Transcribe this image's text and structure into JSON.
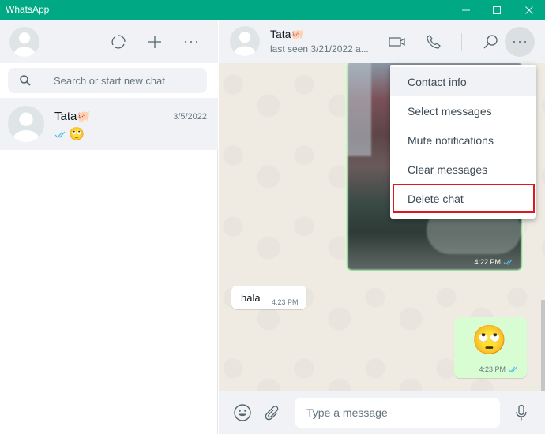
{
  "window": {
    "title": "WhatsApp",
    "accent_color": "#00a884",
    "controls": [
      "minimize",
      "maximize",
      "close"
    ]
  },
  "sidebar": {
    "header_icons": [
      "status-icon",
      "new-chat-icon",
      "more-options-icon"
    ],
    "search": {
      "placeholder": "Search or start new chat",
      "value": ""
    },
    "chats": [
      {
        "name": "Tata",
        "name_emoji": "🐖",
        "date": "3/5/2022",
        "preview_emoji": "🙄",
        "read_status": "double-check-blue"
      }
    ]
  },
  "chat": {
    "contact_name": "Tata",
    "contact_emoji": "🐖",
    "status": "last seen 3/21/2022 a...",
    "header_icons": [
      "video-call-icon",
      "voice-call-icon",
      "search-icon",
      "menu-icon"
    ],
    "messages": [
      {
        "type": "image",
        "direction": "outgoing",
        "time": "4:22 PM",
        "read_status": "double-check-blue"
      },
      {
        "type": "text",
        "direction": "incoming",
        "text": "hala",
        "time": "4:23 PM"
      },
      {
        "type": "emoji",
        "direction": "outgoing",
        "emoji": "🙄",
        "time": "4:23 PM",
        "read_status": "double-check-blue"
      }
    ],
    "composer": {
      "placeholder": "Type a message",
      "value": ""
    }
  },
  "menu": {
    "items": [
      {
        "label": "Contact info",
        "state": "hover"
      },
      {
        "label": "Select messages"
      },
      {
        "label": "Mute notifications"
      },
      {
        "label": "Clear messages"
      },
      {
        "label": "Delete chat",
        "state": "highlighted",
        "highlight_color": "#e0171f"
      }
    ]
  }
}
